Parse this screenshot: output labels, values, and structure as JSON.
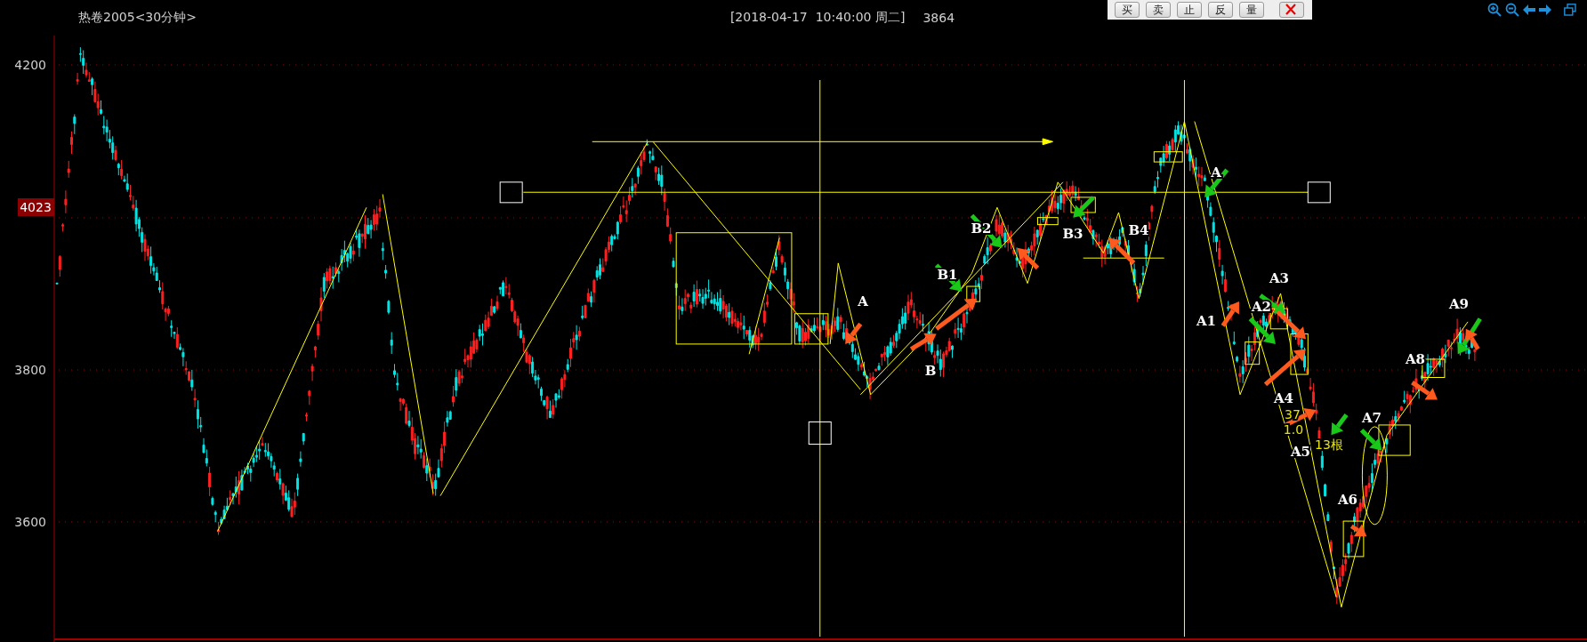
{
  "header": {
    "title": "热卷2005<30分钟>",
    "datetime": "[2018-04-17  10:40:00 周二]",
    "price": "3864"
  },
  "order_toolbar": {
    "buttons": [
      "买",
      "卖",
      "止",
      "反",
      "量"
    ]
  },
  "y_axis": {
    "labels": [
      "4200",
      "3800",
      "3600"
    ],
    "current_price": "4023"
  },
  "annotations": [
    {
      "text": "A",
      "kind": "wave"
    },
    {
      "text": "B1",
      "kind": "wave"
    },
    {
      "text": "B2",
      "kind": "wave"
    },
    {
      "text": "B3",
      "kind": "wave"
    },
    {
      "text": "B4",
      "kind": "wave"
    },
    {
      "text": "A",
      "kind": "wave"
    },
    {
      "text": "B",
      "kind": "wave"
    },
    {
      "text": "A3",
      "kind": "wave"
    },
    {
      "text": "A2",
      "kind": "wave"
    },
    {
      "text": "A1",
      "kind": "wave"
    },
    {
      "text": "A9",
      "kind": "wave"
    },
    {
      "text": "A8",
      "kind": "wave"
    },
    {
      "text": "A4",
      "kind": "wave"
    },
    {
      "text": "A7",
      "kind": "wave"
    },
    {
      "text": "37",
      "kind": "stat"
    },
    {
      "text": "1.0",
      "kind": "stat"
    },
    {
      "text": "13根",
      "kind": "stat"
    },
    {
      "text": "A5",
      "kind": "wave"
    },
    {
      "text": "A6",
      "kind": "wave"
    }
  ]
}
